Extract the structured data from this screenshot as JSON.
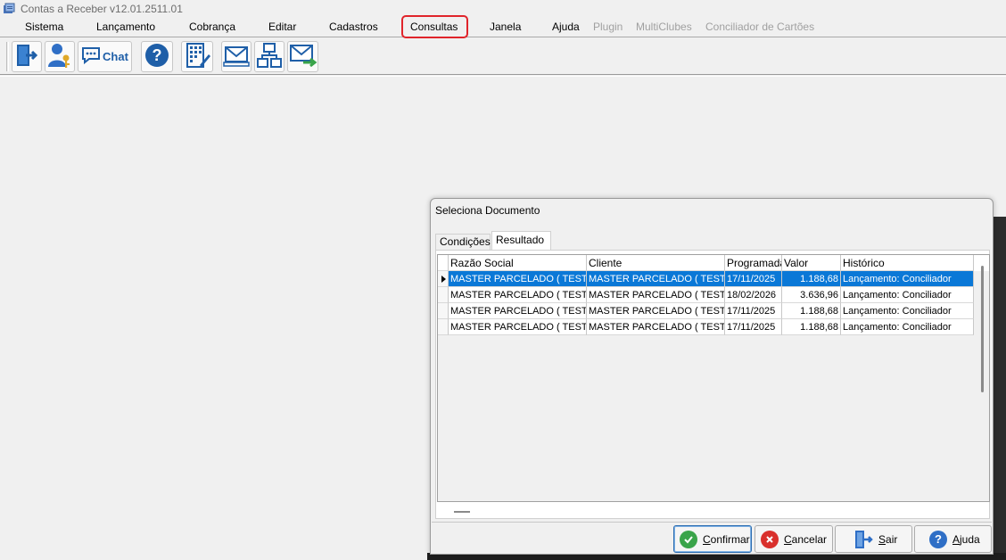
{
  "window": {
    "title": "Contas a Receber v12.01.2511.01"
  },
  "menu": {
    "items": [
      {
        "label": "Sistema",
        "enabled": true
      },
      {
        "label": "Lançamento",
        "enabled": true
      },
      {
        "label": "Cobrança",
        "enabled": true
      },
      {
        "label": "Editar",
        "enabled": true
      },
      {
        "label": "Cadastros",
        "enabled": true
      },
      {
        "label": "Consultas",
        "enabled": true,
        "highlighted": true
      },
      {
        "label": "Janela",
        "enabled": true
      },
      {
        "label": "Ajuda",
        "enabled": true
      },
      {
        "label": "Plugin",
        "enabled": false
      },
      {
        "label": "MultiClubes",
        "enabled": false
      },
      {
        "label": "Conciliador de Cartões",
        "enabled": false
      }
    ],
    "highlight_color": "#e0242b"
  },
  "toolbar": {
    "buttons": [
      {
        "icon": "exit-door-icon"
      },
      {
        "icon": "user-key-icon"
      },
      {
        "icon": "chat-icon",
        "label": "Chat"
      },
      {
        "icon": "help-icon"
      },
      {
        "icon": "calculator-edit-icon"
      },
      {
        "icon": "mail-tray-icon"
      },
      {
        "icon": "network-icon"
      },
      {
        "icon": "mail-forward-icon"
      }
    ]
  },
  "dialog": {
    "title": "Seleciona Documento",
    "tabs": [
      {
        "label": "Condições",
        "active": false
      },
      {
        "label": "Resultado",
        "active": true
      }
    ],
    "grid": {
      "columns": [
        "Razão Social",
        "Cliente",
        "Programada",
        "Valor",
        "Histórico"
      ],
      "rows": [
        {
          "razao": "MASTER PARCELADO ( TESTE)",
          "cliente": "MASTER PARCELADO ( TESTE)",
          "programada": "17/11/2025",
          "valor": "1.188,68",
          "historico": "Lançamento: Conciliador",
          "selected": true
        },
        {
          "razao": "MASTER PARCELADO ( TESTE)",
          "cliente": "MASTER PARCELADO ( TESTE)",
          "programada": "18/02/2026",
          "valor": "3.636,96",
          "historico": "Lançamento: Conciliador",
          "selected": false
        },
        {
          "razao": "MASTER PARCELADO ( TESTE)",
          "cliente": "MASTER PARCELADO ( TESTE)",
          "programada": "17/11/2025",
          "valor": "1.188,68",
          "historico": "Lançamento: Conciliador",
          "selected": false
        },
        {
          "razao": "MASTER PARCELADO ( TESTE)",
          "cliente": "MASTER PARCELADO ( TESTE)",
          "programada": "17/11/2025",
          "valor": "1.188,68",
          "historico": "Lançamento: Conciliador",
          "selected": false
        }
      ],
      "selection_color": "#0a78d7"
    },
    "buttons": {
      "confirm": {
        "prefix": "",
        "accel": "C",
        "rest": "onfirmar",
        "icon": "check-circle-icon",
        "color": "#3aa44a"
      },
      "cancel": {
        "prefix": "",
        "accel": "C",
        "rest": "ancelar",
        "icon": "x-circle-icon",
        "color": "#d9302c"
      },
      "exit": {
        "prefix": "",
        "accel": "S",
        "rest": "air",
        "icon": "exit-door-icon",
        "color": "#2f6fc6"
      },
      "help": {
        "prefix": "",
        "accel": "A",
        "rest": "juda",
        "icon": "help-icon",
        "color": "#2f6fc6"
      }
    }
  }
}
